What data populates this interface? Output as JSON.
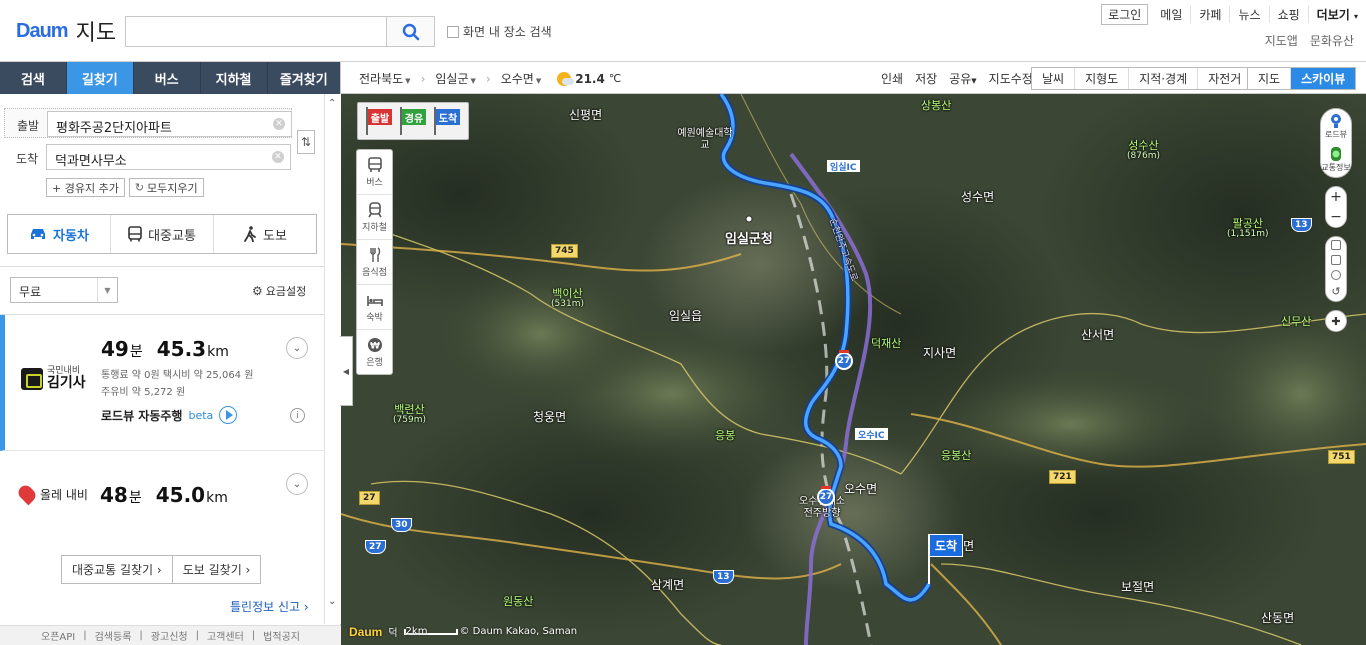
{
  "header": {
    "logo_text": "Daum",
    "service_title": "지도",
    "search_placeholder": "",
    "search_checkbox_label": "화면 내 장소 검색",
    "login_button": "로그인",
    "nav_items": [
      "메일",
      "카페",
      "뉴스",
      "쇼핑"
    ],
    "more_label": "더보기",
    "sub_links": [
      "지도앱",
      "문화유산"
    ]
  },
  "left_tabs": [
    "검색",
    "길찾기",
    "버스",
    "지하철",
    "즐겨찾기"
  ],
  "active_tab": "길찾기",
  "route": {
    "origin_label": "출발",
    "origin_value": "평화주공2단지아파트",
    "destination_label": "도착",
    "destination_value": "덕과면사무소",
    "add_waypoint": "+ 경유지 추가",
    "clear_all": "모두지우기"
  },
  "modes": [
    {
      "label": "자동차",
      "icon": "car-icon"
    },
    {
      "label": "대중교통",
      "icon": "bus-icon"
    },
    {
      "label": "도보",
      "icon": "walk-icon"
    }
  ],
  "active_mode": "자동차",
  "toll_option": "무료",
  "fee_setting_label": "요금설정",
  "results": [
    {
      "provider_small": "국민내비",
      "provider": "김기사",
      "time": "49",
      "time_unit": "분",
      "distance": "45.3",
      "distance_unit": "km",
      "fee_line1": "통행료 약 0원   택시비 약 25,064 원",
      "fee_line2": "주유비 약 5,272 원",
      "roadview": "로드뷰 자동주행",
      "beta": "beta"
    },
    {
      "provider": "올레 내비",
      "time": "48",
      "time_unit": "분",
      "distance": "45.0",
      "distance_unit": "km"
    }
  ],
  "bottom_buttons": [
    "대중교통 길찾기 ›",
    "도보 길찾기 ›"
  ],
  "report_link": "틀린정보 신고 ›",
  "footer_links": [
    "오픈API",
    "검색등록",
    "광고신청",
    "고객센터",
    "법적공지"
  ],
  "map_toolbar": {
    "breadcrumbs": [
      "전라북도",
      "임실군",
      "오수면"
    ],
    "temperature": "21.4",
    "temperature_unit": "℃",
    "tools": [
      "인쇄",
      "저장",
      "공유",
      "지도수정"
    ],
    "overlay_toggles": [
      "날씨",
      "지형도",
      "지적·경계",
      "자전거"
    ],
    "map_types": [
      "지도",
      "스카이뷰"
    ],
    "active_map_type": "스카이뷰"
  },
  "map_flags": [
    "출발",
    "경유",
    "도착"
  ],
  "poi_buttons": [
    "버스",
    "지하철",
    "음식점",
    "숙박",
    "은행"
  ],
  "map_controls": [
    "로드뷰",
    "교통정보"
  ],
  "map_labels": {
    "places": [
      "신평면",
      "예원예술대학교",
      "임실군청",
      "임실읍",
      "성수면",
      "지사면",
      "산서면",
      "청웅면",
      "오수면",
      "삼계면",
      "보절면",
      "산동면",
      "덕과면",
      "오수휴게소 전주방향"
    ],
    "mountains": [
      {
        "name": "상봉산",
        "height": ""
      },
      {
        "name": "성수산",
        "height": "(876m)"
      },
      {
        "name": "팔공산",
        "height": "(1,151m)"
      },
      {
        "name": "백이산",
        "height": "(531m)"
      },
      {
        "name": "덕재산",
        "height": ""
      },
      {
        "name": "신무산",
        "height": ""
      },
      {
        "name": "백련산",
        "height": "(759m)"
      },
      {
        "name": "응봉",
        "height": ""
      },
      {
        "name": "응봉산",
        "height": ""
      },
      {
        "name": "원동산",
        "height": ""
      }
    ],
    "road_numbers": [
      "745",
      "13",
      "721",
      "751",
      "27",
      "30",
      "27",
      "13"
    ],
    "highway_numbers": [
      "27",
      "27"
    ],
    "ic_labels": [
      "임실IC",
      "오수IC"
    ],
    "expressway_name": "순천완주고속도로",
    "destination_flag": "도착"
  },
  "scale": {
    "label": "2km",
    "copyright": "© Daum Kakao, Saman",
    "partial": "덕"
  },
  "colors": {
    "tab_bar": "#3a4a5f",
    "accent_blue": "#3c96e6",
    "route_line": "#4aa3ff"
  }
}
